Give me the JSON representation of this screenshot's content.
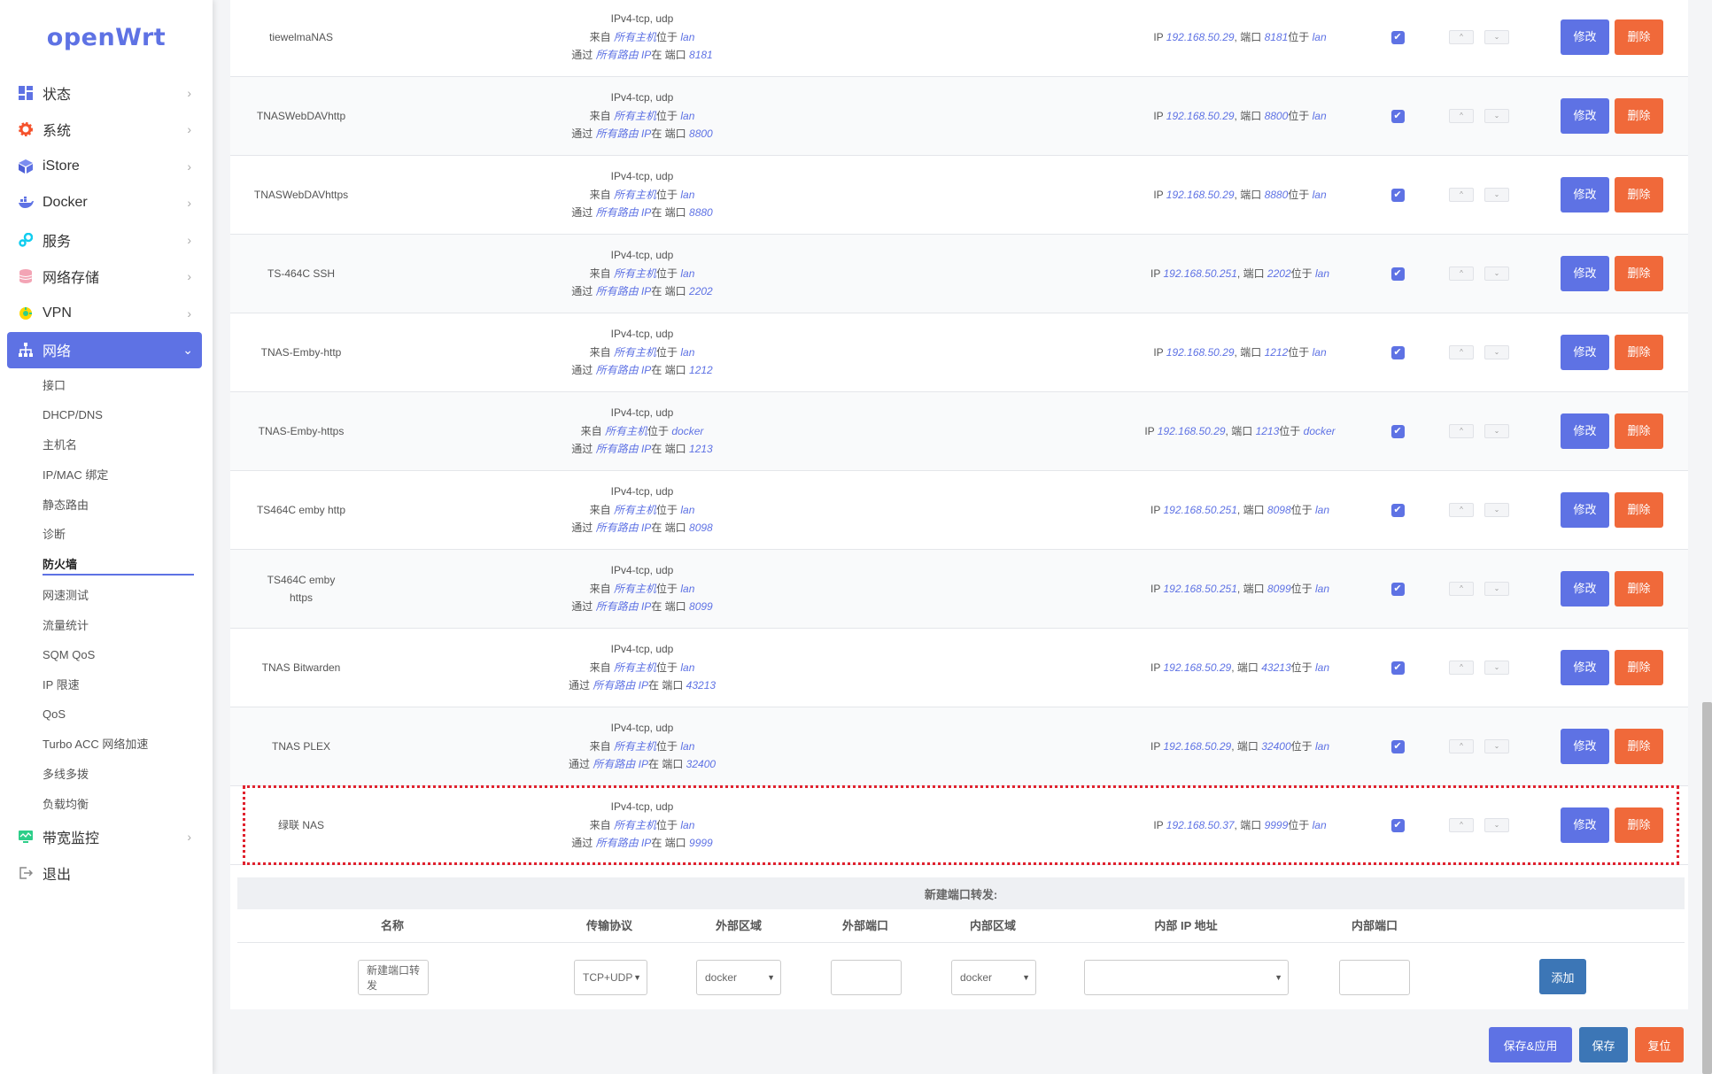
{
  "sidebar": {
    "logo": "openWrt",
    "menu": [
      {
        "label": "状态",
        "icon": "dashboard-icon"
      },
      {
        "label": "系统",
        "icon": "gear-icon"
      },
      {
        "label": "iStore",
        "icon": "cube-icon"
      },
      {
        "label": "Docker",
        "icon": "docker-icon"
      },
      {
        "label": "服务",
        "icon": "services-icon"
      },
      {
        "label": "网络存储",
        "icon": "storage-icon"
      },
      {
        "label": "VPN",
        "icon": "vpn-icon"
      },
      {
        "label": "网络",
        "icon": "network-icon"
      }
    ],
    "submenu": [
      "接口",
      "DHCP/DNS",
      "主机名",
      "IP/MAC 绑定",
      "静态路由",
      "诊断",
      "防火墙",
      "网速测试",
      "流量统计",
      "SQM QoS",
      "IP 限速",
      "QoS",
      "Turbo ACC 网络加速",
      "多线多拨",
      "负载均衡"
    ],
    "bottom_menu": [
      {
        "label": "带宽监控",
        "icon": "monitor-icon"
      },
      {
        "label": "退出",
        "icon": "logout-icon"
      }
    ]
  },
  "rules": [
    {
      "name": "tiewelmaNAS",
      "proto": "IPv4-tcp, udp",
      "from_host": "所有主机",
      "zone": "lan",
      "via_ip": "所有路由 IP",
      "ext_port": "8181",
      "to_ip": "192.168.50.29",
      "to_port": "8181",
      "to_zone": "lan"
    },
    {
      "name": "TNASWebDAVhttp",
      "proto": "IPv4-tcp, udp",
      "from_host": "所有主机",
      "zone": "lan",
      "via_ip": "所有路由 IP",
      "ext_port": "8800",
      "to_ip": "192.168.50.29",
      "to_port": "8800",
      "to_zone": "lan"
    },
    {
      "name": "TNASWebDAVhttps",
      "proto": "IPv4-tcp, udp",
      "from_host": "所有主机",
      "zone": "lan",
      "via_ip": "所有路由 IP",
      "ext_port": "8880",
      "to_ip": "192.168.50.29",
      "to_port": "8880",
      "to_zone": "lan"
    },
    {
      "name": "TS-464C SSH",
      "proto": "IPv4-tcp, udp",
      "from_host": "所有主机",
      "zone": "lan",
      "via_ip": "所有路由 IP",
      "ext_port": "2202",
      "to_ip": "192.168.50.251",
      "to_port": "2202",
      "to_zone": "lan"
    },
    {
      "name": "TNAS-Emby-http",
      "proto": "IPv4-tcp, udp",
      "from_host": "所有主机",
      "zone": "lan",
      "via_ip": "所有路由 IP",
      "ext_port": "1212",
      "to_ip": "192.168.50.29",
      "to_port": "1212",
      "to_zone": "lan"
    },
    {
      "name": "TNAS-Emby-https",
      "proto": "IPv4-tcp, udp",
      "from_host": "所有主机",
      "zone": "docker",
      "via_ip": "所有路由 IP",
      "ext_port": "1213",
      "to_ip": "192.168.50.29",
      "to_port": "1213",
      "to_zone": "docker"
    },
    {
      "name": "TS464C emby http",
      "proto": "IPv4-tcp, udp",
      "from_host": "所有主机",
      "zone": "lan",
      "via_ip": "所有路由 IP",
      "ext_port": "8098",
      "to_ip": "192.168.50.251",
      "to_port": "8098",
      "to_zone": "lan"
    },
    {
      "name": "TS464C emby https",
      "proto": "IPv4-tcp, udp",
      "from_host": "所有主机",
      "zone": "lan",
      "via_ip": "所有路由 IP",
      "ext_port": "8099",
      "to_ip": "192.168.50.251",
      "to_port": "8099",
      "to_zone": "lan"
    },
    {
      "name": "TNAS Bitwarden",
      "proto": "IPv4-tcp, udp",
      "from_host": "所有主机",
      "zone": "lan",
      "via_ip": "所有路由 IP",
      "ext_port": "43213",
      "to_ip": "192.168.50.29",
      "to_port": "43213",
      "to_zone": "lan"
    },
    {
      "name": "TNAS PLEX",
      "proto": "IPv4-tcp, udp",
      "from_host": "所有主机",
      "zone": "lan",
      "via_ip": "所有路由 IP",
      "ext_port": "32400",
      "to_ip": "192.168.50.29",
      "to_port": "32400",
      "to_zone": "lan"
    },
    {
      "name": "绿联 NAS",
      "proto": "IPv4-tcp, udp",
      "from_host": "所有主机",
      "zone": "lan",
      "via_ip": "所有路由 IP",
      "ext_port": "9999",
      "to_ip": "192.168.50.37",
      "to_port": "9999",
      "to_zone": "lan"
    }
  ],
  "row_text": {
    "from_prefix": "来自",
    "located_in": "位于",
    "via_prefix": "通过",
    "at_port": "在 端口",
    "ip_prefix": "IP",
    "port_word": "端口",
    "edit": "修改",
    "delete": "删除",
    "up": "^",
    "down": "⌄",
    "check": "✔"
  },
  "new_forward": {
    "title": "新建端口转发:",
    "headers": [
      "名称",
      "传输协议",
      "外部区域",
      "外部端口",
      "内部区域",
      "内部 IP 地址",
      "内部端口"
    ],
    "name_placeholder": "新建端口转发",
    "proto_value": "TCP+UDP",
    "ext_zone_value": "docker",
    "ext_port_value": "",
    "int_zone_value": "docker",
    "int_ip_value": "",
    "int_port_value": "",
    "add_label": "添加"
  },
  "footer": {
    "save_apply": "保存&应用",
    "save": "保存",
    "reset": "复位"
  },
  "colors": {
    "accent": "#5e72e4",
    "danger": "#f0693a",
    "add": "#3c76b6",
    "highlight": "#e0222e"
  }
}
